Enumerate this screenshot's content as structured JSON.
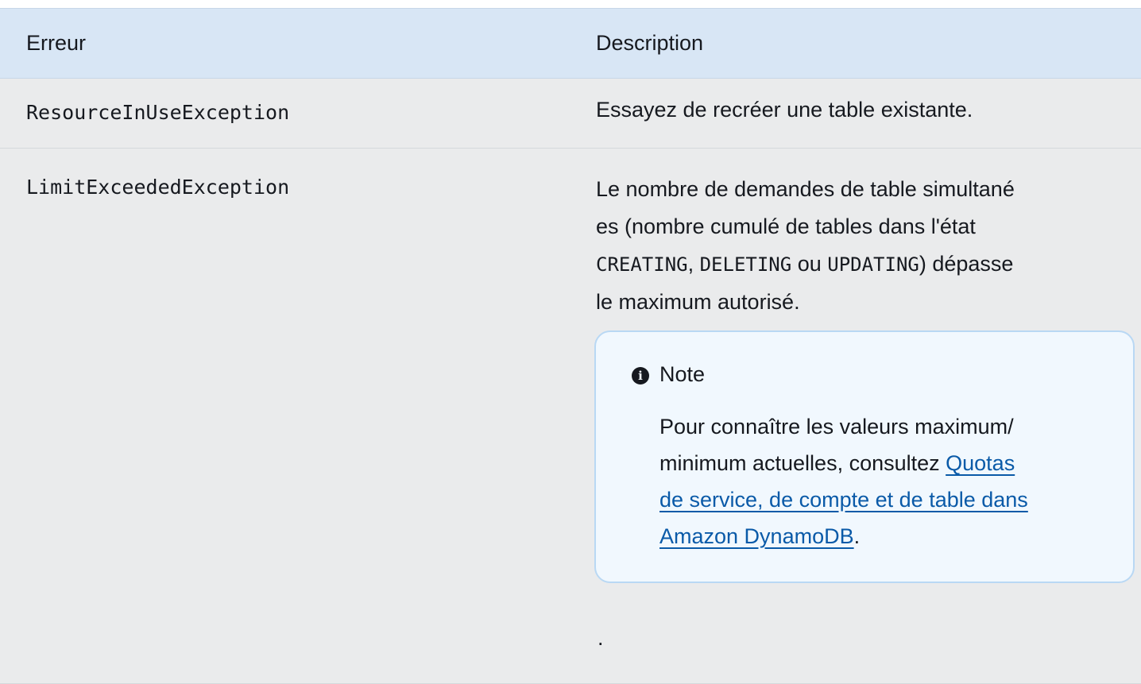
{
  "table": {
    "headers": {
      "error": "Erreur",
      "description": "Description"
    },
    "rows": [
      {
        "error": "ResourceInUseException",
        "description": "Essayez de recréer une table existante."
      },
      {
        "error": "LimitExceededException",
        "description": {
          "line1": "Le nombre de demandes de table simultané",
          "line2": "es (nombre cumulé de tables dans l'état",
          "state1": "CREATING",
          "sep1": ", ",
          "state2": "DELETING",
          "sep2": " ou ",
          "state3": "UPDATING",
          "line3_tail": ") dépasse",
          "line4": "le maximum autorisé."
        },
        "note": {
          "icon": "info-icon",
          "title": "Note",
          "line1": "Pour connaître les valeurs maximum/",
          "line2": "minimum actuelles, consultez ",
          "link_part1": "Quotas",
          "link_part2": "de service, de compte et de table dans",
          "link_part3": "Amazon DynamoDB",
          "period": "."
        },
        "trailing": "."
      }
    ]
  },
  "colors": {
    "header_bg": "#d8e6f5",
    "row_bg": "#eaebec",
    "note_bg": "#f1f8fe",
    "note_border": "#b9d8f4",
    "link": "#0a5aa8"
  }
}
